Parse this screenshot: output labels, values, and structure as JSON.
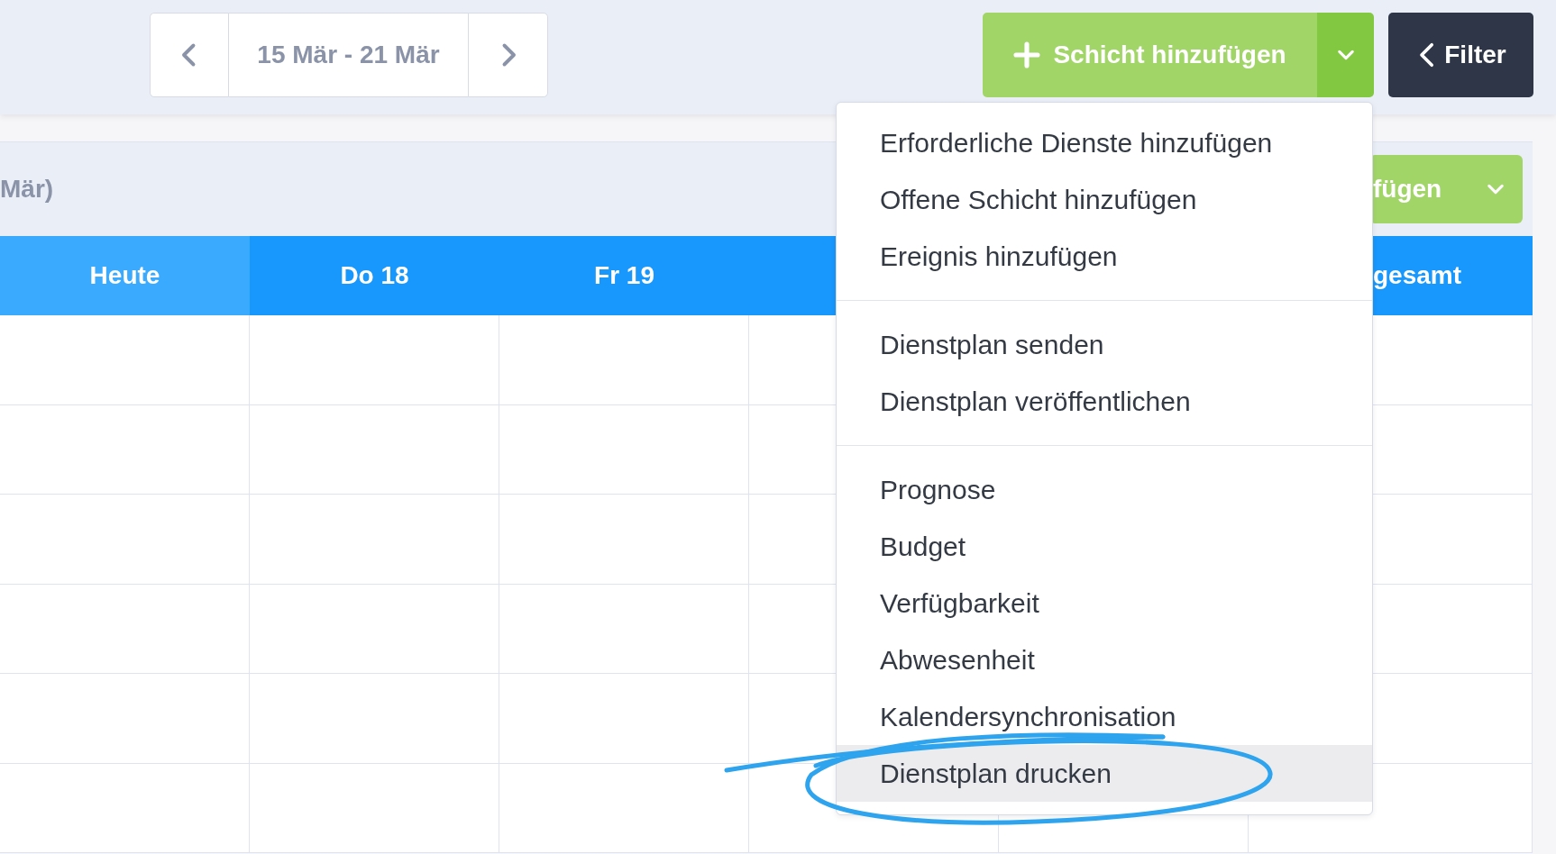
{
  "date_nav": {
    "range": "15 Mär - 21 Mär"
  },
  "add_shift_button": {
    "label": "Schicht hinzufügen"
  },
  "filter_button": {
    "label": "Filter"
  },
  "panel": {
    "title": "Mär)",
    "add_button": {
      "label": "fügen"
    }
  },
  "columns": [
    {
      "label": "Heute",
      "today": true
    },
    {
      "label": "Do 18",
      "today": false
    },
    {
      "label": "Fr 19",
      "today": false
    },
    {
      "label": "gesamt",
      "today": false
    }
  ],
  "menu": {
    "sections": [
      [
        {
          "label": "Erforderliche Dienste hinzufügen",
          "highlighted": false
        },
        {
          "label": "Offene Schicht hinzufügen",
          "highlighted": false
        },
        {
          "label": "Ereignis hinzufügen",
          "highlighted": false
        }
      ],
      [
        {
          "label": "Dienstplan senden",
          "highlighted": false
        },
        {
          "label": "Dienstplan veröffentlichen",
          "highlighted": false
        }
      ],
      [
        {
          "label": "Prognose",
          "highlighted": false
        },
        {
          "label": "Budget",
          "highlighted": false
        },
        {
          "label": "Verfügbarkeit",
          "highlighted": false
        },
        {
          "label": "Abwesenheit",
          "highlighted": false
        },
        {
          "label": "Kalendersynchronisation",
          "highlighted": false
        },
        {
          "label": "Dienstplan drucken",
          "highlighted": true
        }
      ]
    ]
  }
}
